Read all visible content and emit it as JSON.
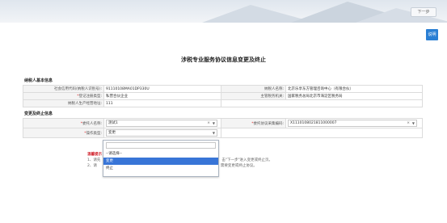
{
  "header": {
    "next_label": "下一步"
  },
  "help_label": "说明",
  "title": "涉税专业服务协议信息变更及终止",
  "taxpayer": {
    "section_title": "纳税人基本信息",
    "credit_code_label": "社会信用代码(纳税人识别号):",
    "credit_code": "91110108MA01DP330U",
    "name_label": "纳税人名称:",
    "name": "北京乐享东方管理咨询中心（有限合伙）",
    "reg_type_label": "*登记注册类型:",
    "reg_type": "私营合伙企业",
    "tax_org_label": "主管税务机关:",
    "tax_org": "国家税务总局北京市海淀区税务局",
    "industry_label": "纳税人生产经营地址:",
    "industry": "111"
  },
  "change": {
    "section_title": "变更及终止信息",
    "agent_label": "*委托人名称:",
    "agent_value": "测试1",
    "agreement_label": "*委托协议采集编码:",
    "agreement_value": "X1110108021811000007",
    "op_type_label": "*操作类型:",
    "op_type_value": "变更"
  },
  "notice": {
    "title": "温馨提示",
    "line1_a": "1、请先",
    "line1_b": "击\"下一步\"进入变更或终止页。",
    "line2_a": "2、请",
    "line2_b": "需要变更或终止协议。"
  },
  "dropdown": {
    "options": [
      "--请选择--",
      "变更",
      "终止"
    ],
    "highlighted_index": 1
  },
  "colors": {
    "accent": "#2a7fd4",
    "highlight": "#3875d7",
    "required": "#e02020"
  }
}
